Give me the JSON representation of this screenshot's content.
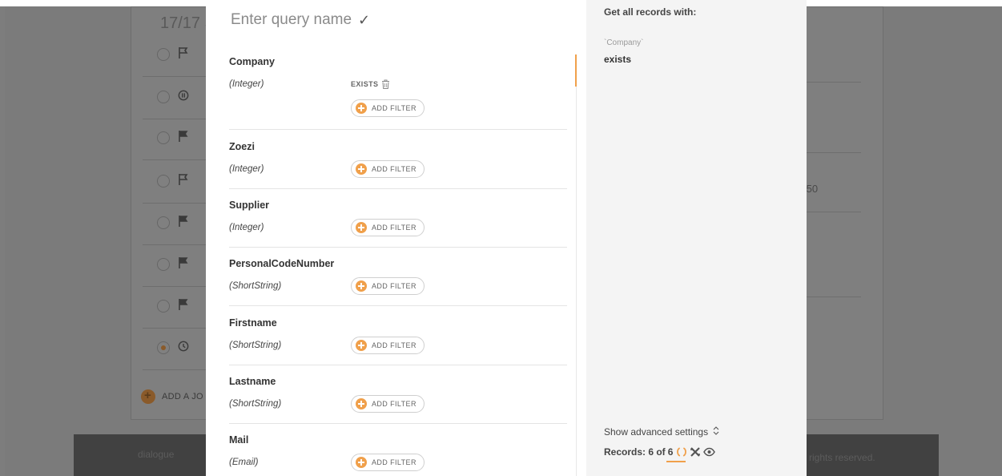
{
  "background": {
    "counter": "17/17 S",
    "add_job_label": "ADD A JO",
    "footer_brand": "dialogue",
    "footer_rights": "rights reserved.",
    "partial_time": ":50"
  },
  "query": {
    "name_placeholder": "Enter query name",
    "confirm_icon": "check-icon"
  },
  "fields": [
    {
      "name": "Company",
      "type": "(Integer)",
      "filter": "EXISTS",
      "add_filter_label": "ADD FILTER"
    },
    {
      "name": "Zoezi",
      "type": "(Integer)",
      "add_filter_label": "ADD FILTER"
    },
    {
      "name": "Supplier",
      "type": "(Integer)",
      "add_filter_label": "ADD FILTER"
    },
    {
      "name": "PersonalCodeNumber",
      "type": "(ShortString)",
      "add_filter_label": "ADD FILTER"
    },
    {
      "name": "Firstname",
      "type": "(ShortString)",
      "add_filter_label": "ADD FILTER"
    },
    {
      "name": "Lastname",
      "type": "(ShortString)",
      "add_filter_label": "ADD FILTER"
    },
    {
      "name": "Mail",
      "type": "(Email)",
      "add_filter_label": "ADD FILTER"
    }
  ],
  "summary": {
    "heading": "Get all records with:",
    "field": "`Company`",
    "condition": "exists",
    "advanced_settings": "Show advanced settings",
    "records_prefix": "Records: 6 of",
    "records_total": "6"
  },
  "colors": {
    "accent": "#f0a04b",
    "overlay": "#7d7d7d",
    "panel_right": "#f4f4f4"
  }
}
